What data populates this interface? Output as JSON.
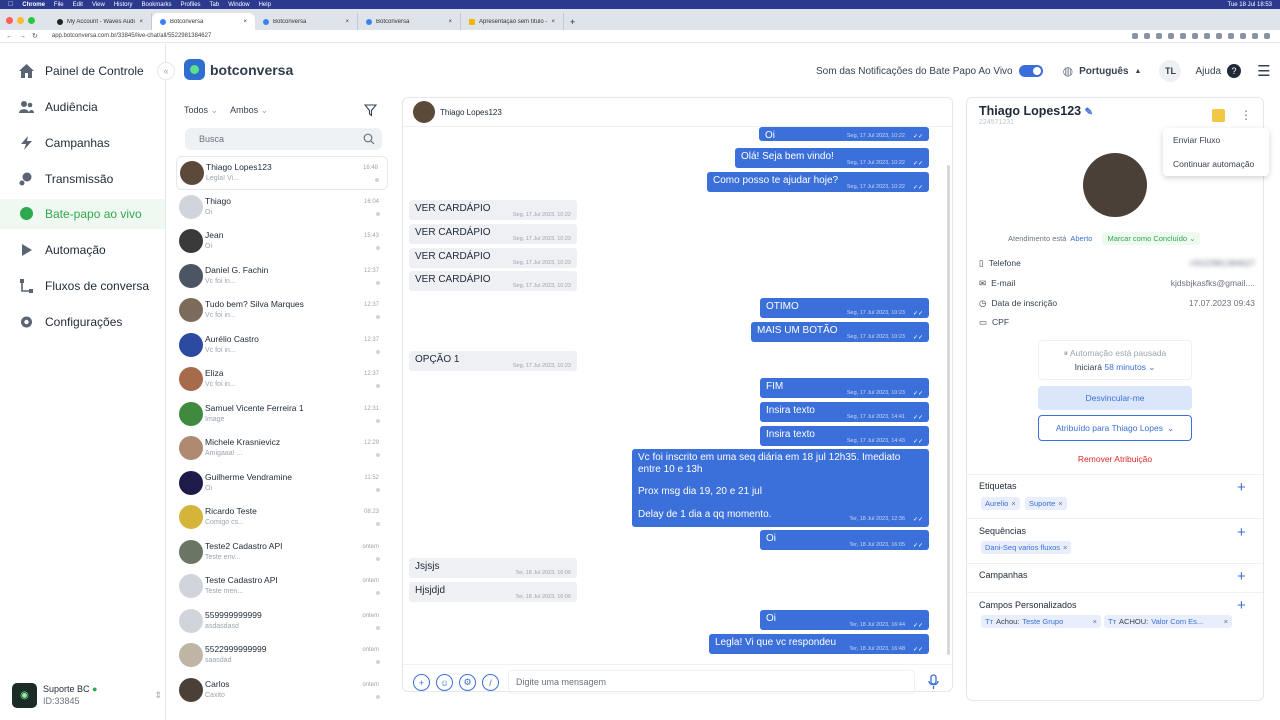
{
  "mac": {
    "app": "Chrome",
    "menu": [
      "File",
      "Edit",
      "View",
      "History",
      "Bookmarks",
      "Profiles",
      "Tab",
      "Window",
      "Help"
    ],
    "clock": "Tue 18 Jul 18:53"
  },
  "browser": {
    "tabs": [
      {
        "title": "My Account - Waves Audio"
      },
      {
        "title": "Botconversa"
      },
      {
        "title": "Botconversa"
      },
      {
        "title": "Botconversa"
      },
      {
        "title": "Apresentação sem título - Apr..."
      }
    ],
    "url": "app.botconversa.com.br/33845/live-chat/all/5522981384627"
  },
  "sidebar": {
    "items": [
      {
        "label": "Painel de Controle",
        "icon": "home-icon"
      },
      {
        "label": "Audiência",
        "icon": "users-icon"
      },
      {
        "label": "Campanhas",
        "icon": "lightning-icon"
      },
      {
        "label": "Transmissão",
        "icon": "broadcast-icon"
      },
      {
        "label": "Bate-papo ao vivo",
        "icon": "chat-icon",
        "active": true
      },
      {
        "label": "Automação",
        "icon": "play-icon"
      },
      {
        "label": "Fluxos de conversa",
        "icon": "flow-icon"
      },
      {
        "label": "Configurações",
        "icon": "gear-icon"
      }
    ],
    "user": {
      "name": "Suporte BC",
      "id": "ID:33845"
    }
  },
  "header": {
    "brand": "botconversa",
    "notifications_label": "Som das Notificações do Bate Papo Ao Vivo",
    "language": "Português",
    "initials": "TL",
    "help": "Ajuda"
  },
  "list": {
    "filter1": "Todos",
    "filter2": "Ambos",
    "search_placeholder": "Busca",
    "conversations": [
      {
        "name": "Thiago Lopes123",
        "preview": "Legla! Vi...",
        "time": "16:48",
        "color": "#5b4a3a"
      },
      {
        "name": "Thiago",
        "preview": "Oi",
        "time": "16:04",
        "color": "#d1d5db"
      },
      {
        "name": "Jean",
        "preview": "Oi",
        "time": "15:43",
        "color": "#3a3a3a"
      },
      {
        "name": "Daniel G. Fachin",
        "preview": "Vc foi in...",
        "time": "12:37",
        "color": "#4b5563"
      },
      {
        "name": "Tudo bem? Silva Marques",
        "preview": "Vc foi in...",
        "time": "12:37",
        "color": "#7c6a5a"
      },
      {
        "name": "Aurélio Castro",
        "preview": "Vc foi in...",
        "time": "12:37",
        "color": "#2b4aa0"
      },
      {
        "name": "Eliza",
        "preview": "Vc foi in...",
        "time": "12:37",
        "color": "#a56b4b"
      },
      {
        "name": "Samuel Vicente Ferreira 1",
        "preview": "Image",
        "time": "12:31",
        "color": "#3f8a3f"
      },
      {
        "name": "Michele Krasnievicz",
        "preview": "Amigaaa! ...",
        "time": "12:29",
        "color": "#b08a70"
      },
      {
        "name": "Guilherme Vendramine",
        "preview": "Oi",
        "time": "11:52",
        "color": "#1e1b4b"
      },
      {
        "name": "Ricardo Teste",
        "preview": "Comigo cs...",
        "time": "08:23",
        "color": "#d4b53a"
      },
      {
        "name": "Teste2 Cadastro API",
        "preview": "Teste env...",
        "time": "ontem",
        "color": "#6b7563"
      },
      {
        "name": "Teste Cadastro API",
        "preview": "Teste men...",
        "time": "ontem",
        "color": "#d1d5db"
      },
      {
        "name": "559999999999",
        "preview": "asdasdasd",
        "time": "ontem",
        "color": "#d1d5db"
      },
      {
        "name": "5522999999999",
        "preview": "saasdad",
        "time": "ontem",
        "color": "#bfb5a5"
      },
      {
        "name": "Carlos",
        "preview": "Caxito",
        "time": "ontem",
        "color": "#4a4038"
      }
    ]
  },
  "chat": {
    "contact": "Thiago Lopes123",
    "messages": [
      {
        "dir": "out",
        "text": "Oi",
        "time": "Seg, 17 Jul 2023, 10:22"
      },
      {
        "dir": "out",
        "text": "Olá! Seja bem vindo!",
        "time": "Seg, 17 Jul 2023, 10:22"
      },
      {
        "dir": "out",
        "text": "Como posso te ajudar hoje?",
        "time": "Seg, 17 Jul 2023, 10:22"
      },
      {
        "dir": "in",
        "text": "VER CARDÁPIO",
        "time": "Seg, 17 Jul 2023, 10:22"
      },
      {
        "dir": "in",
        "text": "VER CARDÁPIO",
        "time": "Seg, 17 Jul 2023, 10:23"
      },
      {
        "dir": "in",
        "text": "VER CARDÁPIO",
        "time": "Seg, 17 Jul 2023, 10:23"
      },
      {
        "dir": "in",
        "text": "VER CARDÁPIO",
        "time": "Seg, 17 Jul 2023, 10:23"
      },
      {
        "dir": "out",
        "text": "OTIMO",
        "time": "Seg, 17 Jul 2023, 10:23"
      },
      {
        "dir": "out",
        "text": "MAIS UM BOTÃO",
        "time": "Seg, 17 Jul 2023, 10:23"
      },
      {
        "dir": "in",
        "text": "OPÇÃO 1",
        "time": "Seg, 17 Jul 2023, 10:23"
      },
      {
        "dir": "out",
        "text": "FIM",
        "time": "Seg, 17 Jul 2023, 10:23"
      },
      {
        "dir": "out",
        "text": "Insira texto",
        "time": "Seg, 17 Jul 2023, 14:41"
      },
      {
        "dir": "out",
        "text": "Insira texto",
        "time": "Seg, 17 Jul 2023, 14:43"
      },
      {
        "dir": "out",
        "text": "Vc foi inscrito em uma seq diária em 18 jul 12h35. Imediato entre 10 e 13h",
        "text2": "Prox msg dia 19, 20 e 21 jul",
        "text3": "Delay de 1 dia a qq momento.",
        "time": "Ter, 18 Jul 2023, 12:36"
      },
      {
        "dir": "out",
        "text": "Oi",
        "time": "Ter, 18 Jul 2023, 16:05"
      },
      {
        "dir": "in",
        "text": "Jsjsjs",
        "time": "Ter, 18 Jul 2023, 16:06"
      },
      {
        "dir": "in",
        "text": "Hjsjdjd",
        "time": "Ter, 18 Jul 2023, 16:06"
      },
      {
        "dir": "out",
        "text": "Oi",
        "time": "Ter, 18 Jul 2023, 16:44"
      },
      {
        "dir": "out",
        "text": "Legla! Vi que vc respondeu",
        "time": "Ter, 18 Jul 2023, 16:48"
      }
    ],
    "input_placeholder": "Digite uma mensagem"
  },
  "contact_panel": {
    "name": "Thiago Lopes123",
    "id": "224571231",
    "menu": [
      "Enviar Fluxo",
      "Continuar automação"
    ],
    "status_label": "Atendimento está",
    "status_value": "Aberto",
    "mark_done": "Marcar como Concluído",
    "fields": [
      {
        "label": "Telefone",
        "value": "+5522981384627",
        "icon": "phone-icon"
      },
      {
        "label": "E-mail",
        "value": "kjdsbjkasfks@gmail....",
        "icon": "mail-icon"
      },
      {
        "label": "Data de inscrição",
        "value": "17.07.2023 09:43",
        "icon": "clock-icon"
      },
      {
        "label": "CPF",
        "value": "",
        "icon": "id-card-icon"
      }
    ],
    "automation_paused": "Automação está pausada",
    "starts_label": "Iniciará",
    "starts_in": "58 minutos",
    "unlink": "Desvincular-me",
    "assigned": "Atribuído para Thiago Lopes",
    "remove_assign": "Remover Atribuição",
    "tags_title": "Etiquetas",
    "tags": [
      "Aurelio",
      "Suporte"
    ],
    "seq_title": "Sequências",
    "sequences": [
      "Dani-Seq varios fluxos"
    ],
    "camp_title": "Campanhas",
    "custom_title": "Campos Personalizados",
    "custom_fields": [
      {
        "name": "Achou:",
        "value": "Teste Grupo"
      },
      {
        "name": "ACHOU:",
        "value": "Valor Com Es..."
      }
    ]
  },
  "colors": {
    "accent": "#3b6fd9",
    "active_green": "#2fa84f"
  }
}
